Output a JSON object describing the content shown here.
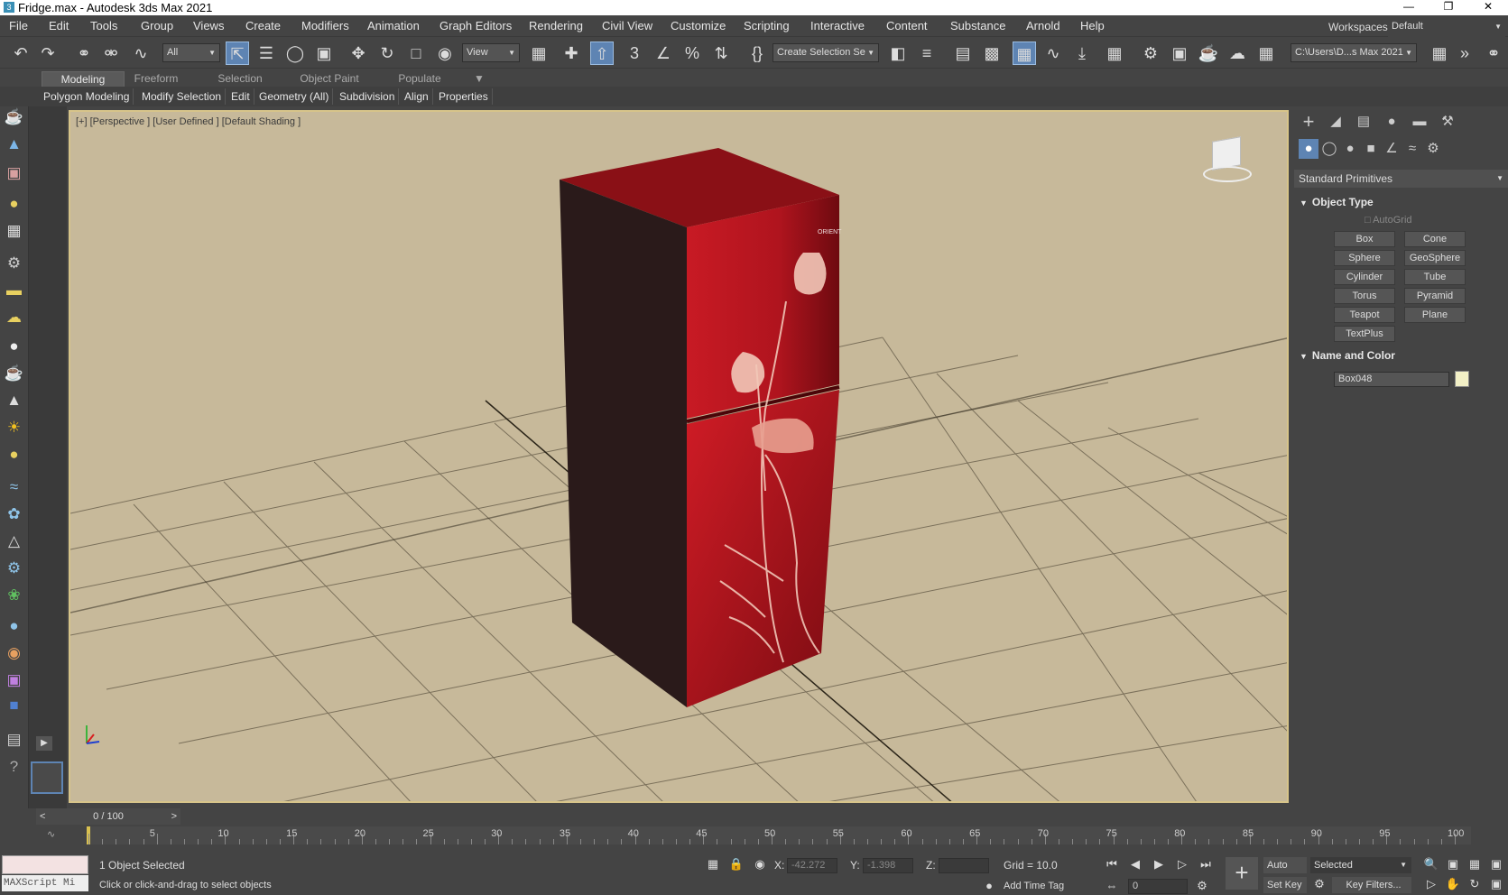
{
  "window": {
    "title": "Fridge.max - Autodesk 3ds Max 2021",
    "icon": "3ds-max-app-icon"
  },
  "menu": {
    "items": [
      "File",
      "Edit",
      "Tools",
      "Group",
      "Views",
      "Create",
      "Modifiers",
      "Animation",
      "Graph Editors",
      "Rendering",
      "Civil View",
      "Customize",
      "Scripting",
      "Interactive",
      "Content",
      "Substance",
      "Arnold",
      "Help"
    ],
    "workspaces_label": "Workspaces:",
    "workspaces_value": "Default"
  },
  "toolbar": {
    "selection_filter": "All",
    "ref_coord": "View",
    "selection_set": "Create Selection Se",
    "project_path": "C:\\Users\\D...s Max 2021"
  },
  "ribbon": {
    "tabs": [
      "Modeling",
      "Freeform",
      "Selection",
      "Object Paint",
      "Populate"
    ],
    "subtabs": [
      "Polygon Modeling",
      "Modify Selection",
      "Edit",
      "Geometry (All)",
      "Subdivision",
      "Align",
      "Properties"
    ]
  },
  "viewport": {
    "label": "[+] [Perspective ] [User Defined ] [Default Shading ]",
    "fridge_brand": "ORIENT",
    "background": "#c7b99a"
  },
  "command_panel": {
    "category": "Standard Primitives",
    "object_type": {
      "title": "Object Type",
      "autogrid": "AutoGrid",
      "buttons": [
        "Box",
        "Cone",
        "Sphere",
        "GeoSphere",
        "Cylinder",
        "Tube",
        "Torus",
        "Pyramid",
        "Teapot",
        "Plane",
        "TextPlus"
      ]
    },
    "name_and_color": {
      "title": "Name and Color",
      "name": "Box048",
      "color": "#f2f0c6"
    }
  },
  "timeline": {
    "frame": "0 / 100",
    "prev": "<",
    "next": ">",
    "ticks": [
      "5",
      "10",
      "15",
      "20",
      "25",
      "30",
      "35",
      "40",
      "45",
      "50",
      "55",
      "60",
      "65",
      "70",
      "75",
      "80",
      "85",
      "90",
      "95",
      "100"
    ]
  },
  "status": {
    "maxscript": "MAXScript Mi",
    "selected": "1 Object Selected",
    "prompt": "Click or click-and-drag to select objects",
    "x_label": "X:",
    "x_value": "-42.272",
    "y_label": "Y:",
    "y_value": "-1.398",
    "z_label": "Z:",
    "z_value": "",
    "grid": "Grid = 10.0",
    "add_time_tag": "Add Time Tag",
    "auto_key": "Auto Key",
    "set_key": "Set Key",
    "key_mode": "Selected",
    "key_filters": "Key Filters...",
    "frame_input": "0"
  }
}
